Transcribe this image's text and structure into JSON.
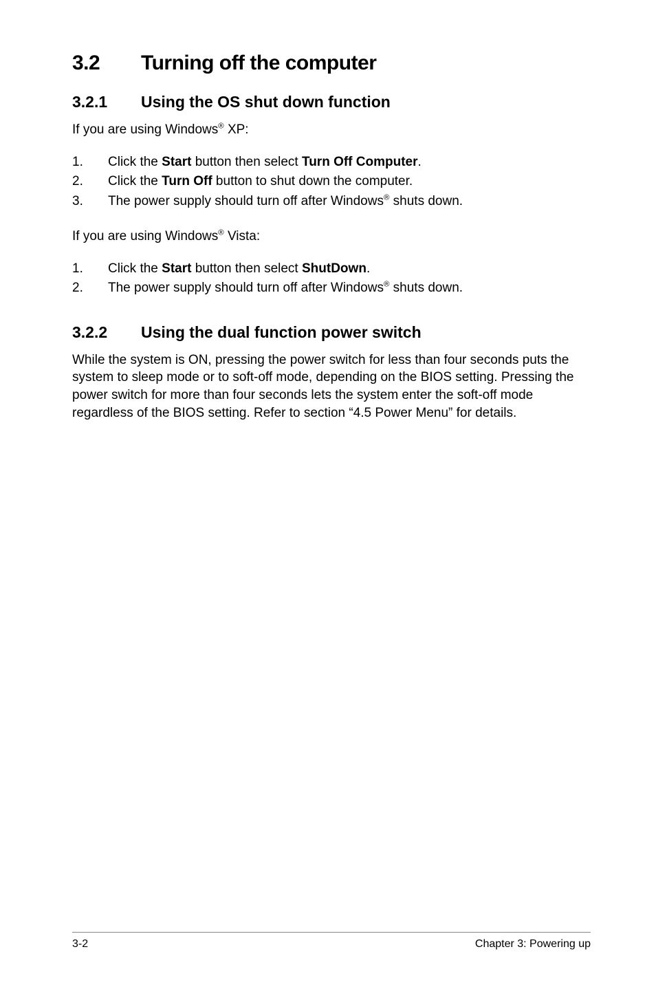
{
  "heading": {
    "number": "3.2",
    "title": "Turning off the computer"
  },
  "section1": {
    "number": "3.2.1",
    "title": "Using the OS shut down function",
    "intro_xp_pre": "If you are using Windows",
    "intro_xp_sup": "®",
    "intro_xp_post": " XP:",
    "steps_xp": [
      {
        "n": "1.",
        "pre": "Click the ",
        "b1": "Start",
        "mid": " button then select ",
        "b2": "Turn Off Computer",
        "post": "."
      },
      {
        "n": "2.",
        "pre": "Click the ",
        "b1": "Turn Off",
        "mid": " button to shut down the computer.",
        "b2": "",
        "post": ""
      },
      {
        "n": "3.",
        "pre": "The power supply should turn off after Windows",
        "sup": "®",
        "post": " shuts down."
      }
    ],
    "intro_vista_pre": "If you are using Windows",
    "intro_vista_sup": "®",
    "intro_vista_post": " Vista:",
    "steps_vista": [
      {
        "n": "1.",
        "pre": "Click the ",
        "b1": "Start",
        "mid": " button then select ",
        "b2": "ShutDown",
        "post": "."
      },
      {
        "n": "2.",
        "pre": "The power supply should turn off after Windows",
        "sup": "®",
        "post": " shuts down."
      }
    ]
  },
  "section2": {
    "number": "3.2.2",
    "title": "Using the dual function power switch",
    "body": "While the system is ON, pressing the power switch for less than four seconds puts the system to sleep mode or to soft-off mode, depending on the BIOS setting. Pressing the power switch for more than four seconds lets the system enter the soft-off mode regardless of the BIOS setting. Refer to section  “4.5 Power Menu” for details."
  },
  "footer": {
    "left": "3-2",
    "right": "Chapter 3: Powering up"
  }
}
